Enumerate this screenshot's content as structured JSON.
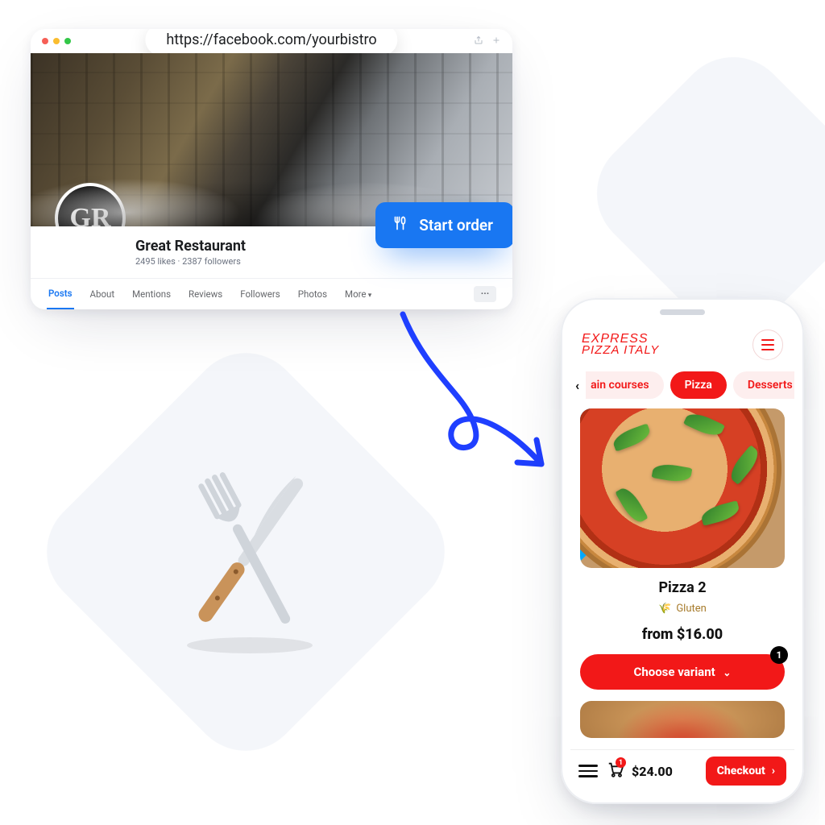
{
  "browser": {
    "url": "https://facebook.com/yourbistro",
    "avatar_initials": "GR",
    "page_name": "Great Restaurant",
    "stats": "2495 likes · 2387 followers",
    "start_order_label": "Start order",
    "tabs": [
      "Posts",
      "About",
      "Mentions",
      "Reviews",
      "Followers",
      "Photos"
    ],
    "more_label": "More",
    "overflow_label": "···"
  },
  "phone": {
    "brand_line1": "EXPRESS",
    "brand_line2": "PIZZA ITALY",
    "categories": {
      "prev_partial": "ain courses",
      "active": "Pizza",
      "next_partial": "Desserts"
    },
    "product": {
      "name": "Pizza 2",
      "allergen": "Gluten",
      "price": "from $16.00",
      "choose_label": "Choose variant",
      "choose_badge": "1"
    },
    "bottom": {
      "cart_count": "1",
      "cart_total": "$24.00",
      "checkout_label": "Checkout"
    }
  }
}
